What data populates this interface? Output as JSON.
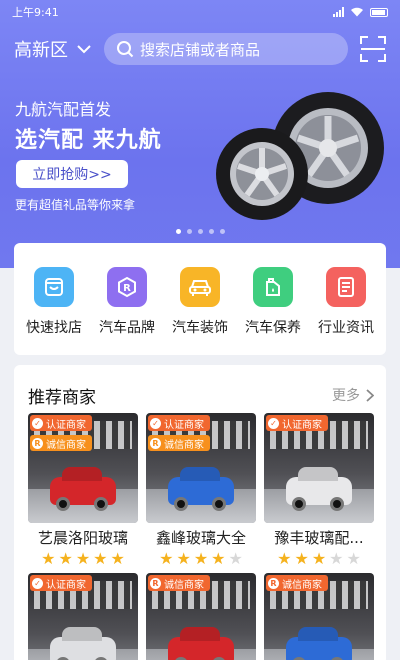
{
  "status": {
    "time": "上午9:41"
  },
  "header": {
    "city": "高新区",
    "search_placeholder": "搜索店铺或者商品"
  },
  "banner": {
    "subtitle": "九航汽配首发",
    "title": "选汽配 来九航",
    "button": "立即抢购>>",
    "note": "更有超值礼品等你来拿",
    "active_dot": 0,
    "dot_count": 5
  },
  "categories": [
    {
      "label": "快速找店",
      "icon": "store-icon",
      "color": "#4db4f5"
    },
    {
      "label": "汽车品牌",
      "icon": "brand-r-icon",
      "color": "#8e6ff0"
    },
    {
      "label": "汽车装饰",
      "icon": "car-icon",
      "color": "#f8b527"
    },
    {
      "label": "汽车保养",
      "icon": "oil-can-icon",
      "color": "#3fce7f"
    },
    {
      "label": "行业资讯",
      "icon": "news-icon",
      "color": "#f4625f"
    }
  ],
  "recommend": {
    "title": "推荐商家",
    "more": "更多",
    "merchants": [
      {
        "name": "艺晨洛阳玻璃",
        "badges": [
          "认证商家",
          "诚信商家"
        ],
        "rating": 5,
        "car_color": "#d4262a"
      },
      {
        "name": "鑫峰玻璃大全",
        "badges": [
          "认证商家",
          "诚信商家"
        ],
        "rating": 4,
        "car_color": "#2d6bd6"
      },
      {
        "name": "豫丰玻璃配...",
        "badges": [
          "认证商家"
        ],
        "rating": 3,
        "car_color": "#e8e8ea"
      },
      {
        "name": "",
        "badges": [
          "认证商家"
        ],
        "rating": 0,
        "car_color": "#dedfe2"
      },
      {
        "name": "",
        "badges": [
          "诚信商家"
        ],
        "rating": 0,
        "car_color": "#d4262a"
      },
      {
        "name": "",
        "badges": [
          "诚信商家"
        ],
        "rating": 0,
        "car_color": "#2d6bd6"
      }
    ]
  },
  "colors": {
    "primary": "#6c73ee",
    "star": "#f5b21e",
    "badge": "#f1672f"
  }
}
